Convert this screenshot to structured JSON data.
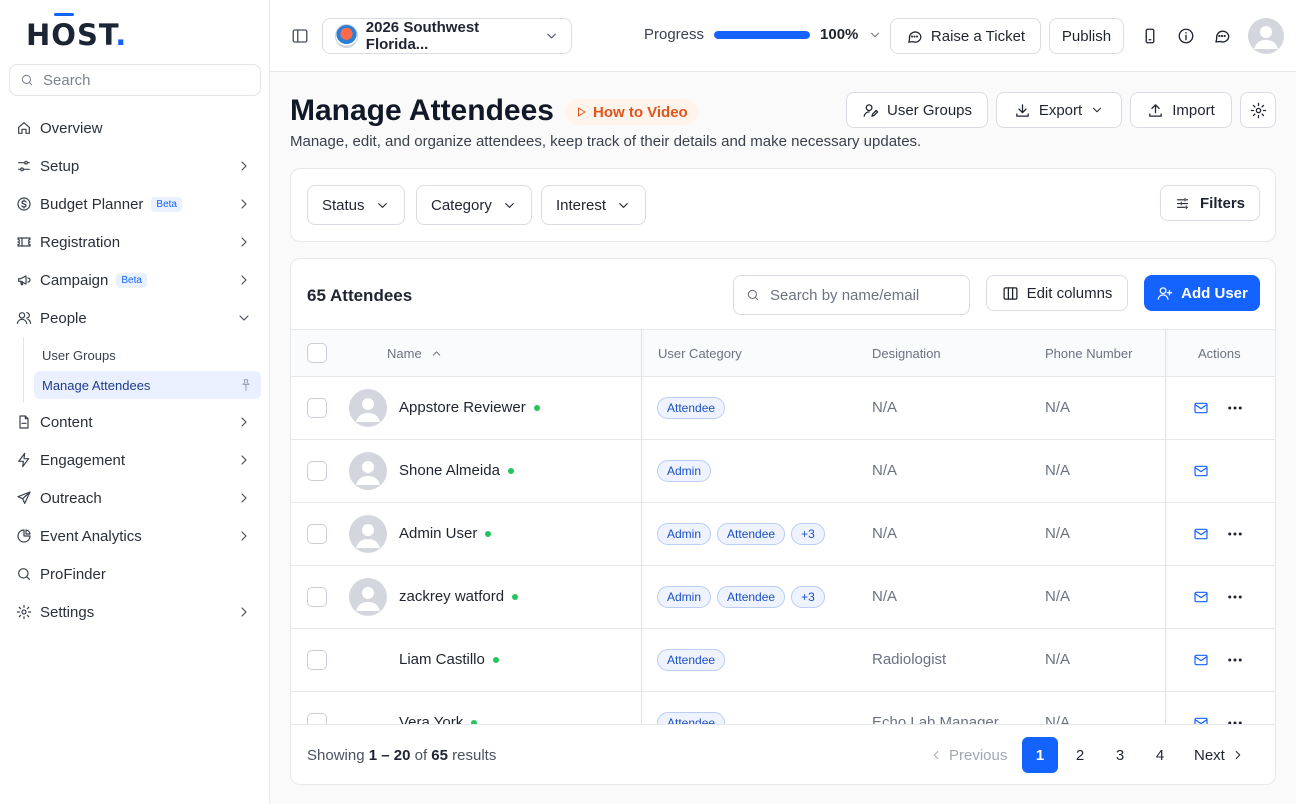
{
  "brand": {
    "logo_text_h": "H",
    "logo_text_o": "O",
    "logo_text_st": "ST",
    "logo_dot": "."
  },
  "sidebar": {
    "search_placeholder": "Search",
    "items": [
      {
        "label": "Overview",
        "icon": "home-icon",
        "chevron": false
      },
      {
        "label": "Setup",
        "icon": "sliders-icon",
        "chevron": true
      },
      {
        "label": "Budget Planner",
        "icon": "dollar-icon",
        "chevron": true,
        "badge": "Beta"
      },
      {
        "label": "Registration",
        "icon": "ticket-icon",
        "chevron": true
      },
      {
        "label": "Campaign",
        "icon": "megaphone-icon",
        "chevron": true,
        "badge": "Beta"
      },
      {
        "label": "People",
        "icon": "users-icon",
        "chevron": true,
        "expanded": true
      },
      {
        "label": "Content",
        "icon": "file-icon",
        "chevron": true
      },
      {
        "label": "Engagement",
        "icon": "zap-icon",
        "chevron": true
      },
      {
        "label": "Outreach",
        "icon": "send-icon",
        "chevron": true
      },
      {
        "label": "Event Analytics",
        "icon": "pie-icon",
        "chevron": true
      },
      {
        "label": "ProFinder",
        "icon": "search-icon",
        "chevron": false
      },
      {
        "label": "Settings",
        "icon": "gear-icon",
        "chevron": true
      }
    ],
    "people_sub": [
      {
        "label": "User Groups",
        "active": false
      },
      {
        "label": "Manage Attendees",
        "active": true
      }
    ]
  },
  "topbar": {
    "event_name": "2026 Southwest Florida...",
    "progress_label": "Progress",
    "progress_value": 1.0,
    "progress_text": "100%",
    "raise_ticket": "Raise a Ticket",
    "publish": "Publish"
  },
  "header": {
    "title": "Manage Attendees",
    "how_to": "How to Video",
    "subtitle": "Manage, edit, and organize attendees, keep track of their details and make necessary updates.",
    "user_groups": "User Groups",
    "export": "Export",
    "import": "Import"
  },
  "filters": {
    "status": "Status",
    "category": "Category",
    "interest": "Interest",
    "filters": "Filters"
  },
  "table": {
    "count_text": "65 Attendees",
    "search_placeholder": "Search by name/email",
    "edit_columns": "Edit columns",
    "add_user": "Add User",
    "columns": {
      "name": "Name",
      "category": "User Category",
      "designation": "Designation",
      "phone": "Phone Number",
      "actions": "Actions"
    },
    "rows": [
      {
        "name": "Appstore Reviewer",
        "avatar": true,
        "tags": [
          "Attendee"
        ],
        "designation": "N/A",
        "phone": "N/A",
        "more": true
      },
      {
        "name": "Shone Almeida",
        "avatar": true,
        "tags": [
          "Admin"
        ],
        "designation": "N/A",
        "phone": "N/A",
        "more": false
      },
      {
        "name": "Admin User",
        "avatar": true,
        "tags": [
          "Admin",
          "Attendee",
          "+3"
        ],
        "designation": "N/A",
        "phone": "N/A",
        "more": true
      },
      {
        "name": "zackrey watford",
        "avatar": true,
        "tags": [
          "Admin",
          "Attendee",
          "+3"
        ],
        "designation": "N/A",
        "phone": "N/A",
        "more": true
      },
      {
        "name": "Liam Castillo",
        "avatar": false,
        "tags": [
          "Attendee"
        ],
        "designation": "Radiologist",
        "phone": "N/A",
        "more": true
      },
      {
        "name": "Vera York",
        "avatar": false,
        "tags": [
          "Attendee"
        ],
        "designation": "Echo Lab Manager",
        "phone": "N/A",
        "more": true
      }
    ]
  },
  "footer": {
    "showing_prefix": "Showing",
    "range_start": "1",
    "range_sep": "–",
    "range_end": "20",
    "of": "of",
    "total": "65",
    "results": "results",
    "previous": "Previous",
    "pages": [
      "1",
      "2",
      "3",
      "4"
    ],
    "current_page": "1",
    "next": "Next"
  },
  "colors": {
    "accent": "#1463ff",
    "online": "#22c55e",
    "howto": "#e0551b"
  }
}
